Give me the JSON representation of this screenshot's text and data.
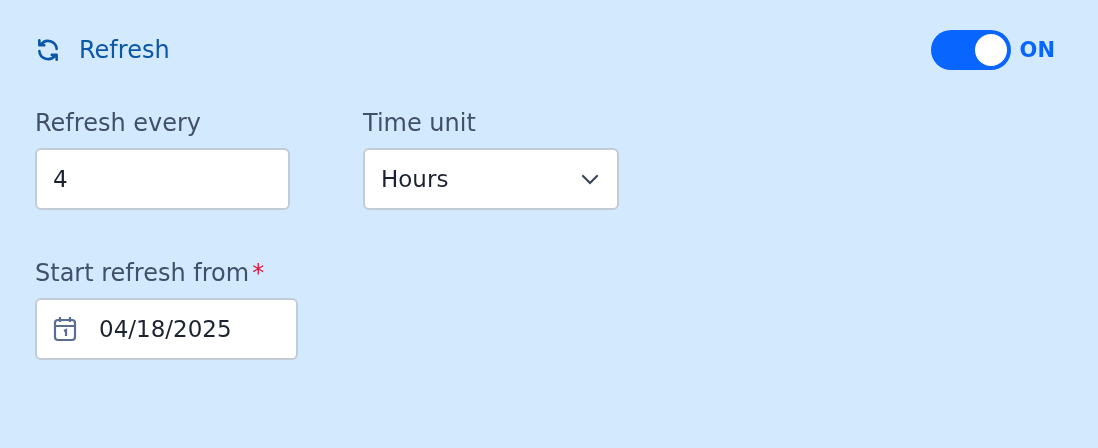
{
  "header": {
    "title": "Refresh",
    "toggle": {
      "on": true,
      "label": "ON"
    }
  },
  "fields": [
    {
      "kind": "text",
      "label": "Refresh every",
      "value": "4"
    },
    {
      "kind": "select",
      "label": "Time unit",
      "value": "Hours"
    }
  ],
  "start": {
    "kind": "date",
    "label": "Start refresh from",
    "required_mark": "*",
    "value": "04/18/2025"
  }
}
